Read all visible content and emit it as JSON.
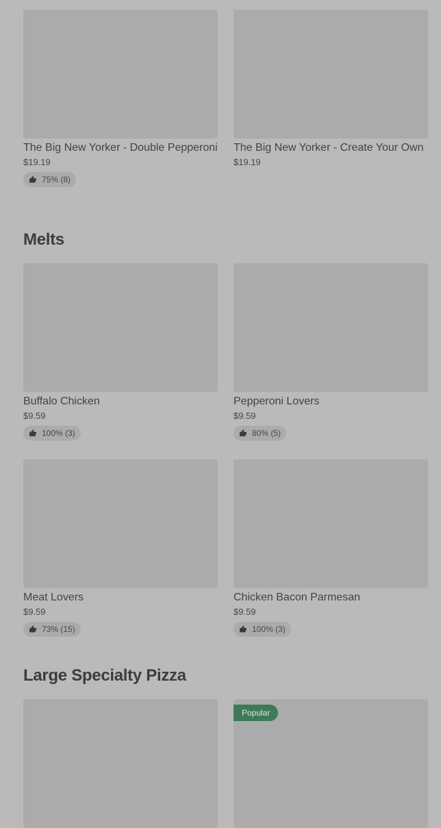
{
  "sections": [
    {
      "title": "",
      "items": [
        {
          "name": "The Big New Yorker - Double Pepperoni",
          "price": "$19.19",
          "rating": "75% (8)"
        },
        {
          "name": "The Big New Yorker - Create Your Own",
          "price": "$19.19"
        }
      ]
    },
    {
      "title": "Melts",
      "items": [
        {
          "name": "Buffalo Chicken",
          "price": "$9.59",
          "rating": "100% (3)"
        },
        {
          "name": "Pepperoni Lovers",
          "price": "$9.59",
          "rating": "80% (5)"
        },
        {
          "name": "Meat Lovers",
          "price": "$9.59",
          "rating": "73% (15)"
        },
        {
          "name": "Chicken Bacon Parmesan",
          "price": "$9.59",
          "rating": "100% (3)"
        }
      ]
    },
    {
      "title": "Large Specialty Pizza",
      "items": [
        {
          "name": ""
        },
        {
          "name": "",
          "badge": "Popular"
        }
      ]
    }
  ],
  "icons": {
    "rating": "thumbs-up-icon"
  },
  "colors": {
    "popular_badge": "#3f7a58",
    "background": "#bababa"
  }
}
